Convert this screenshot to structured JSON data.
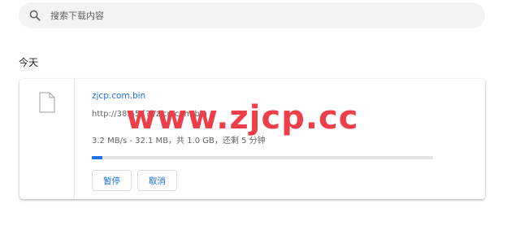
{
  "search": {
    "placeholder": "搜索下载内容",
    "icon": "search-icon"
  },
  "section": {
    "title": "今天"
  },
  "download": {
    "file_icon": "file-icon",
    "file_name": "zjcp.com.bin",
    "url": "http://38.55.[?]/zjcp.com.bin",
    "status": "3.2 MB/s - 32.1 MB，共 1.0 GB，还剩 5 分钟",
    "progress_percent": 3,
    "pause_label": "暂停",
    "cancel_label": "取消"
  },
  "watermark": {
    "text": "www.zjcp.cc"
  },
  "colors": {
    "accent": "#1a73e8",
    "watermark": "#ee3e4a",
    "search_bg": "#f1f3f4",
    "progress_track": "#e2e3e5"
  }
}
